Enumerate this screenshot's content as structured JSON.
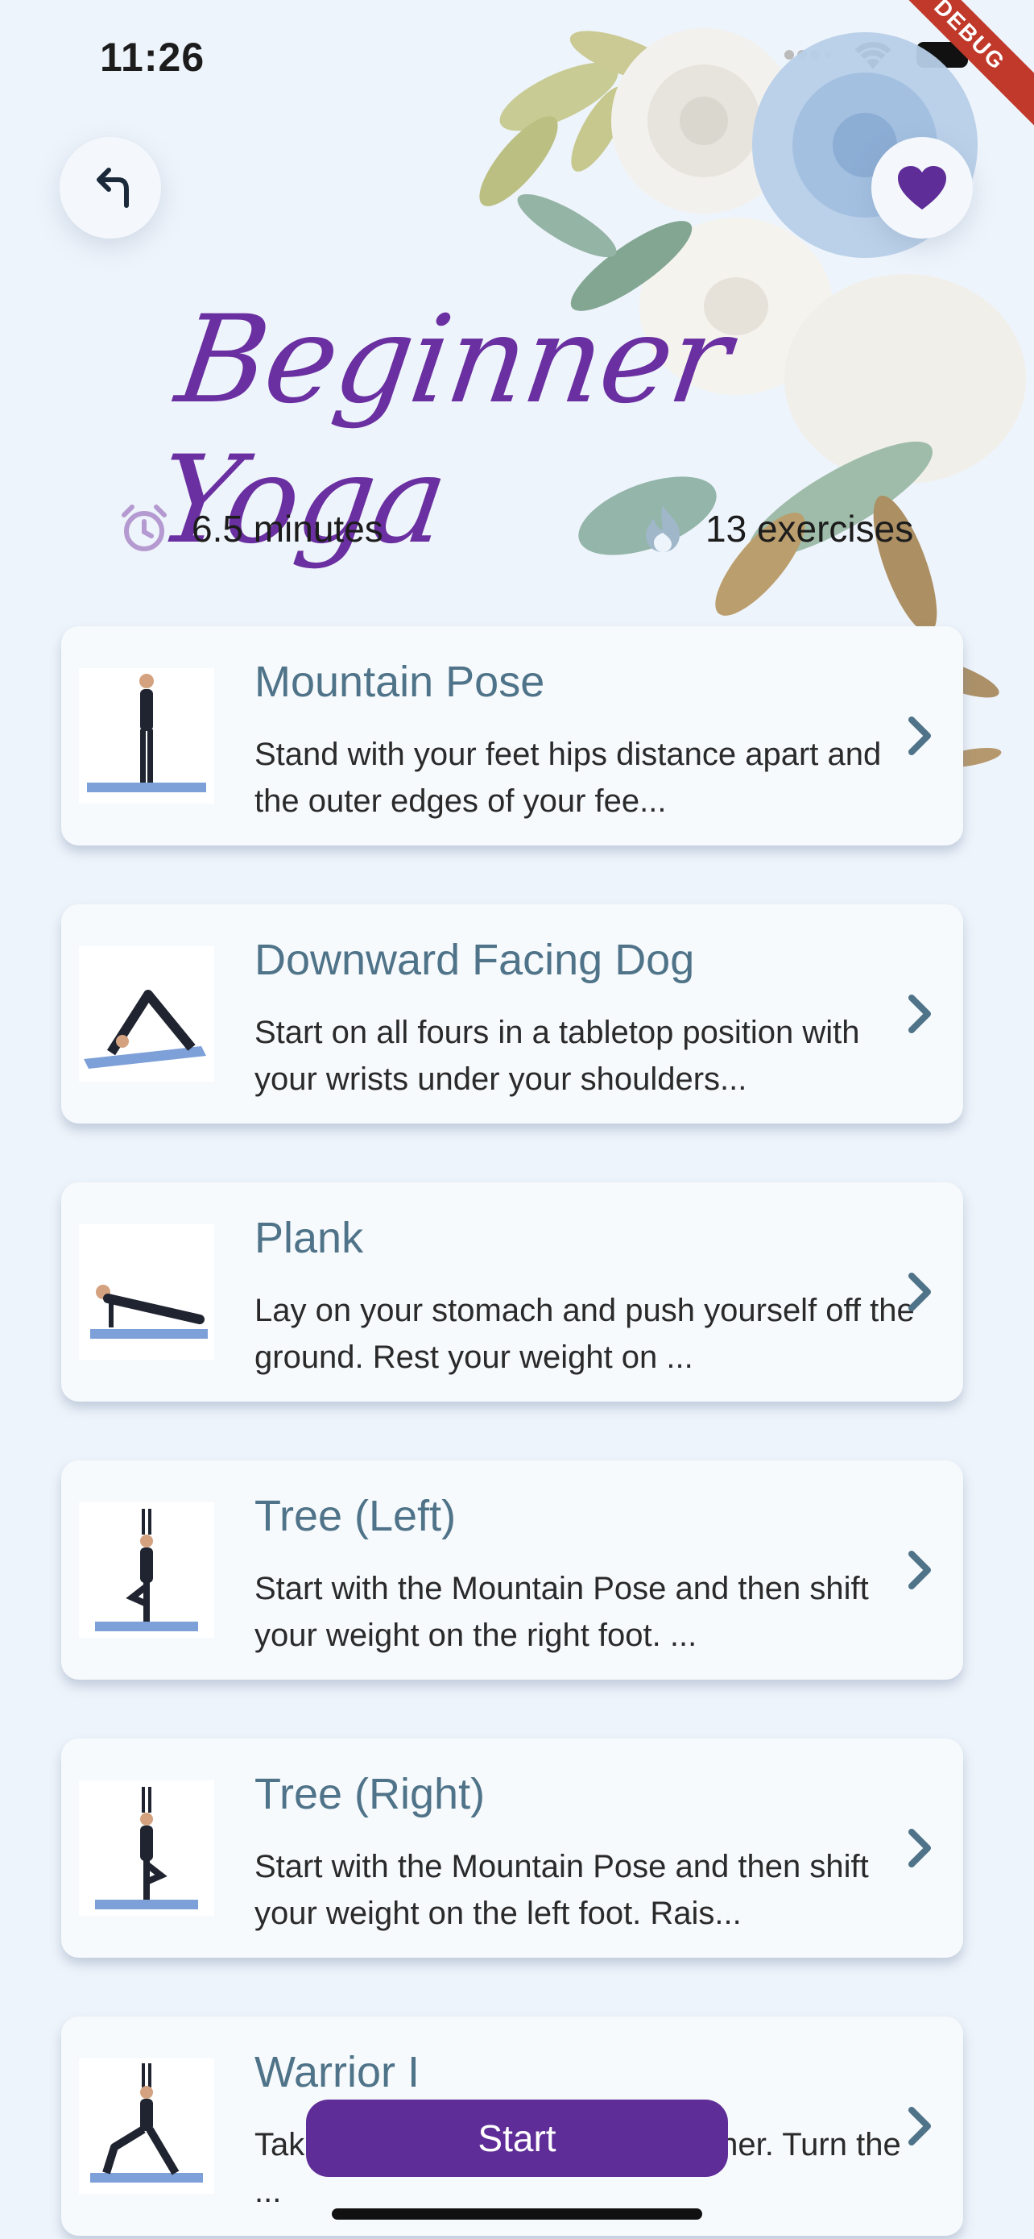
{
  "status": {
    "time": "11:26",
    "debug": "DEBUG"
  },
  "header": {
    "title": "Beginner Yoga",
    "duration": "6.5 minutes",
    "exercises": "13 exercises"
  },
  "exercises": [
    {
      "title": "Mountain Pose",
      "desc": "Stand with your feet hips distance apart and the outer edges of your fee..."
    },
    {
      "title": "Downward Facing Dog",
      "desc": "Start on all fours in a tabletop position with your wrists under your shoulders..."
    },
    {
      "title": "Plank",
      "desc": "Lay on your stomach and push yourself off the ground. Rest your weight on ..."
    },
    {
      "title": "Tree (Left)",
      "desc": "Start with the Mountain Pose and then shift your weight on the right foot. ..."
    },
    {
      "title": "Tree (Right)",
      "desc": "Start with the Mountain Pose and then shift your weight on the left foot. Rais..."
    },
    {
      "title": "Warrior I",
      "desc": "Take your feet parallel to each other. Turn the ..."
    }
  ],
  "actions": {
    "start": "Start"
  },
  "colors": {
    "accent": "#5f2d97",
    "title": "#6a2fa0",
    "card_title": "#4f7388",
    "background": "#eef4fb"
  }
}
